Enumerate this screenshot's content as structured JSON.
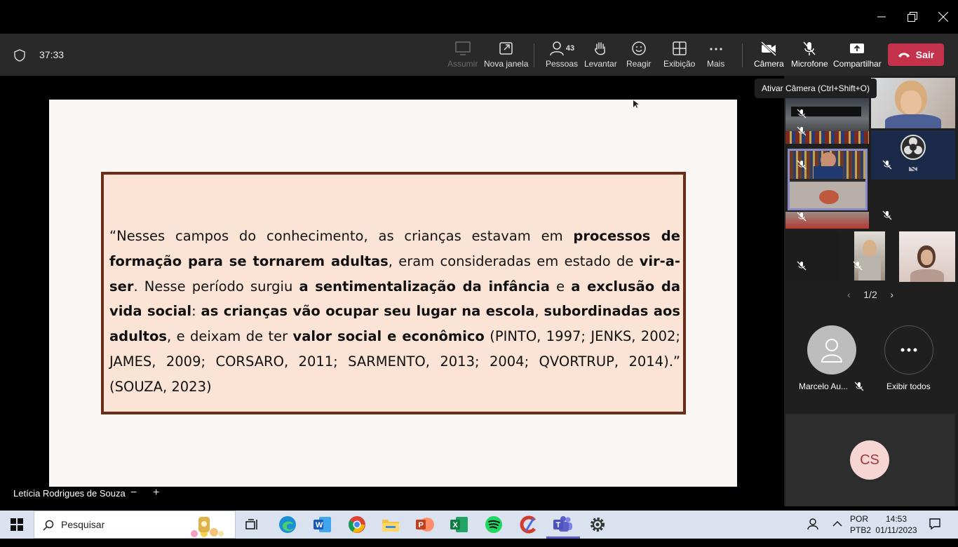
{
  "meeting": {
    "timer": "37:33"
  },
  "toolbar": {
    "assumir": "Assumir",
    "nova_janela": "Nova janela",
    "pessoas": "Pessoas",
    "pessoas_count": "43",
    "levantar": "Levantar",
    "reagir": "Reagir",
    "exibicao": "Exibição",
    "mais": "Mais",
    "camera": "Câmera",
    "microfone": "Microfone",
    "compartilhar": "Compartilhar",
    "sair": "Sair"
  },
  "tooltip": "Ativar Câmera (Ctrl+Shift+O)",
  "slide": {
    "q1": "“Nesses campos do conhecimento, as crianças estavam em ",
    "b1": "processos de formação para se tornarem adultas",
    "q2": ", eram consideradas em estado de ",
    "b2": "vir-a-ser",
    "q3": ". Nesse período surgiu ",
    "b3": "a sentimentalização da infância",
    "q4": " e ",
    "b4": "a exclusão da vida social",
    "q5": ": ",
    "b5": "as crianças vão ocupar seu lugar na escola",
    "q6": ", ",
    "b6": "subordinadas aos adultos",
    "q7": ", e deixam de ter ",
    "b7": "valor social e econômico",
    "q8": " (PINTO, 1997; JENKS, 2002; JAMES, 2009; CORSARO, 2011; SARMENTO, 2013; 2004; QVORTRUP, 2014).”  (SOUZA, 2023)"
  },
  "presenter": {
    "name": "Letícia Rodrigues de Souza",
    "zoom_out": "−",
    "zoom_in": "+"
  },
  "gallery": {
    "page": "1/2",
    "prev": "‹",
    "next": "›",
    "participant_name": "Marcelo Au...",
    "show_all": "Exibir todos",
    "cs_initials": "CS"
  },
  "taskbar": {
    "search_placeholder": "Pesquisar",
    "lang1": "POR",
    "lang2": "PTB2",
    "time": "14:53",
    "date": "01/11/2023"
  },
  "colors": {
    "leave_red": "#c4314b",
    "box_border": "#6b2c17",
    "box_fill": "#fbe4d6",
    "highlight": "#8b8cc7"
  }
}
